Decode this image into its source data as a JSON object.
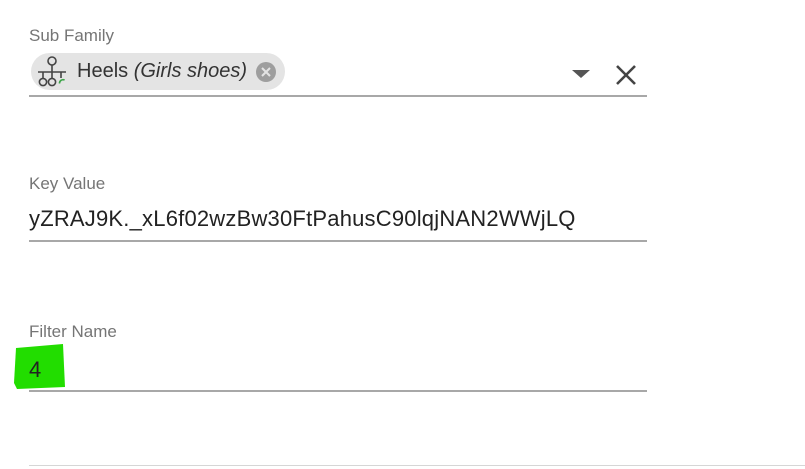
{
  "sub_family": {
    "label": "Sub Family",
    "chip": {
      "icon": "hierarchy-icon",
      "name": "Heels",
      "parent": "(Girls shoes)"
    }
  },
  "key_value": {
    "label": "Key Value",
    "value": "yZRAJ9K._xL6f02wzBw30FtPahusC90lqjNAN2WWjLQ"
  },
  "filter_name": {
    "label": "Filter Name",
    "value": "4",
    "highlight_color": "#22dd00"
  },
  "colors": {
    "label": "#757575",
    "underline": "#a8a8a8",
    "chip_background": "#e4e4e4",
    "chip_remove": "#9e9e9e"
  }
}
